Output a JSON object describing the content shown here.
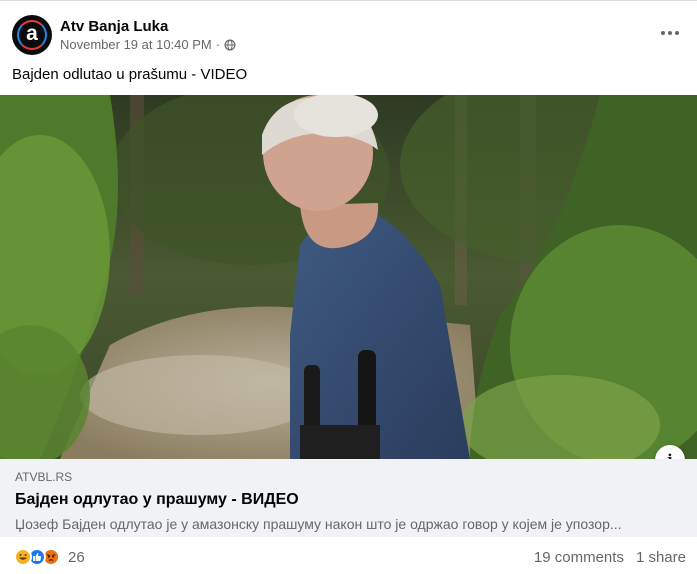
{
  "post": {
    "author": "Atv Banja Luka",
    "avatar_letter": "a",
    "timestamp": "November 19 at 10:40 PM",
    "separator": "·",
    "privacy_icon": "globe-icon",
    "caption": "Bajden odlutao u prašumu - VIDEO",
    "more_icon": "more-options-icon"
  },
  "link_preview": {
    "domain": "ATVBL.RS",
    "title": "Бајден одлутао у прашуму - ВИДЕО",
    "description": "Џозеф Бајден одлутао је у амазонску прашуму након што је одржао говор у којем је упозор...",
    "info_icon": "info-icon",
    "info_glyph": "i"
  },
  "engagement": {
    "reactions": [
      "haha-reaction-icon",
      "like-reaction-icon",
      "angry-reaction-icon"
    ],
    "reaction_count": "26",
    "comments": "19 comments",
    "shares": "1 share"
  },
  "colors": {
    "name": "#050505",
    "secondary": "#65676b",
    "link_bg": "#f0f2f5",
    "like_blue": "#1877f2",
    "haha_yellow": "#f7b125",
    "angry_orange": "#e9710f"
  }
}
